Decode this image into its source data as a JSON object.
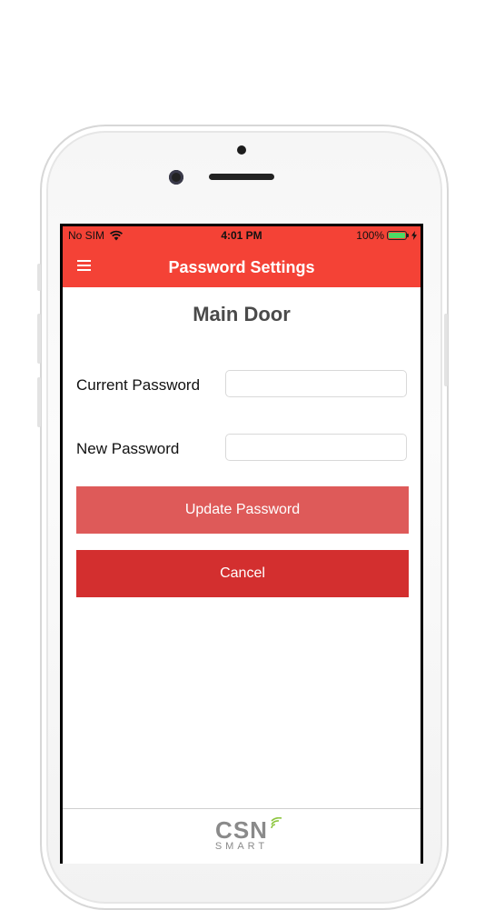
{
  "status_bar": {
    "carrier": "No SIM",
    "time": "4:01 PM",
    "battery": "100%"
  },
  "nav": {
    "title": "Password Settings"
  },
  "page": {
    "title": "Main Door"
  },
  "form": {
    "current_password_label": "Current Password",
    "current_password_value": "",
    "new_password_label": "New Password",
    "new_password_value": "",
    "update_button": "Update Password",
    "cancel_button": "Cancel"
  },
  "footer": {
    "logo_main": "CSN",
    "logo_sub": "SMART"
  },
  "colors": {
    "header": "#f44236",
    "update_button": "#de5a59",
    "cancel_button": "#d32f2f",
    "logo_accent": "#8dc63f"
  }
}
